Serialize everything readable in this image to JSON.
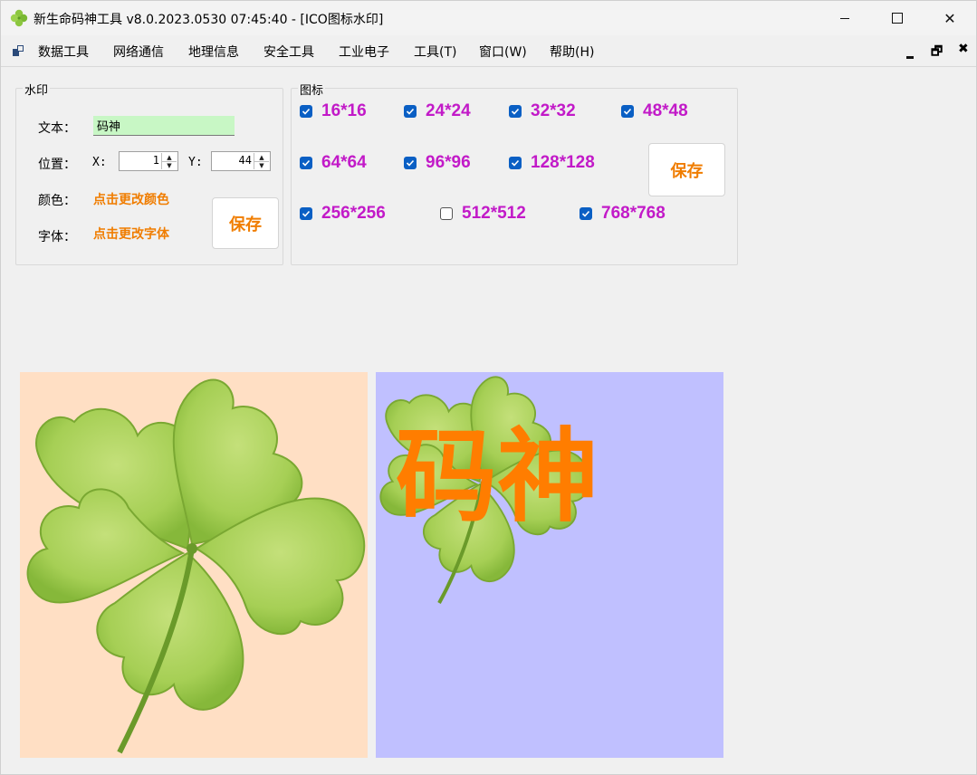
{
  "window": {
    "title": "新生命码神工具 v8.0.2023.0530 07:45:40 - [ICO图标水印]",
    "controls": {
      "close": "✕"
    }
  },
  "menu": {
    "items": [
      "数据工具",
      "网络通信",
      "地理信息",
      "安全工具",
      "工业电子",
      "工具(T)",
      "窗口(W)",
      "帮助(H)"
    ],
    "mdi_controls": {
      "restore": "🗗",
      "close": "✖"
    }
  },
  "watermark": {
    "group_title": "水印",
    "text_label": "文本：",
    "text_value": "码神",
    "position_label": "位置：",
    "x_label": "X:",
    "x_value": "1",
    "y_label": "Y:",
    "y_value": "44",
    "color_label": "颜色：",
    "color_link": "点击更改颜色",
    "font_label": "字体：",
    "font_link": "点击更改字体",
    "save_label": "保存"
  },
  "icons": {
    "group_title": "图标",
    "sizes": [
      {
        "label": "16*16",
        "checked": true
      },
      {
        "label": "24*24",
        "checked": true
      },
      {
        "label": "32*32",
        "checked": true
      },
      {
        "label": "48*48",
        "checked": true
      },
      {
        "label": "64*64",
        "checked": true
      },
      {
        "label": "96*96",
        "checked": true
      },
      {
        "label": "128*128",
        "checked": true
      },
      {
        "label": "256*256",
        "checked": true
      },
      {
        "label": "512*512",
        "checked": false
      },
      {
        "label": "768*768",
        "checked": true
      }
    ],
    "save_label": "保存"
  },
  "preview": {
    "watermark_text": "码神",
    "colors": {
      "original_bg": "#ffdfc4",
      "result_bg": "#c0c0ff",
      "watermark": "#ff7d00",
      "leaf": "#a6cf55"
    }
  },
  "colors": {
    "accent_orange": "#f07d00",
    "checkbox_label": "#c21ac8",
    "checkbox_checked": "#0a5fc4",
    "text_field_bg": "#c8f7c5"
  }
}
